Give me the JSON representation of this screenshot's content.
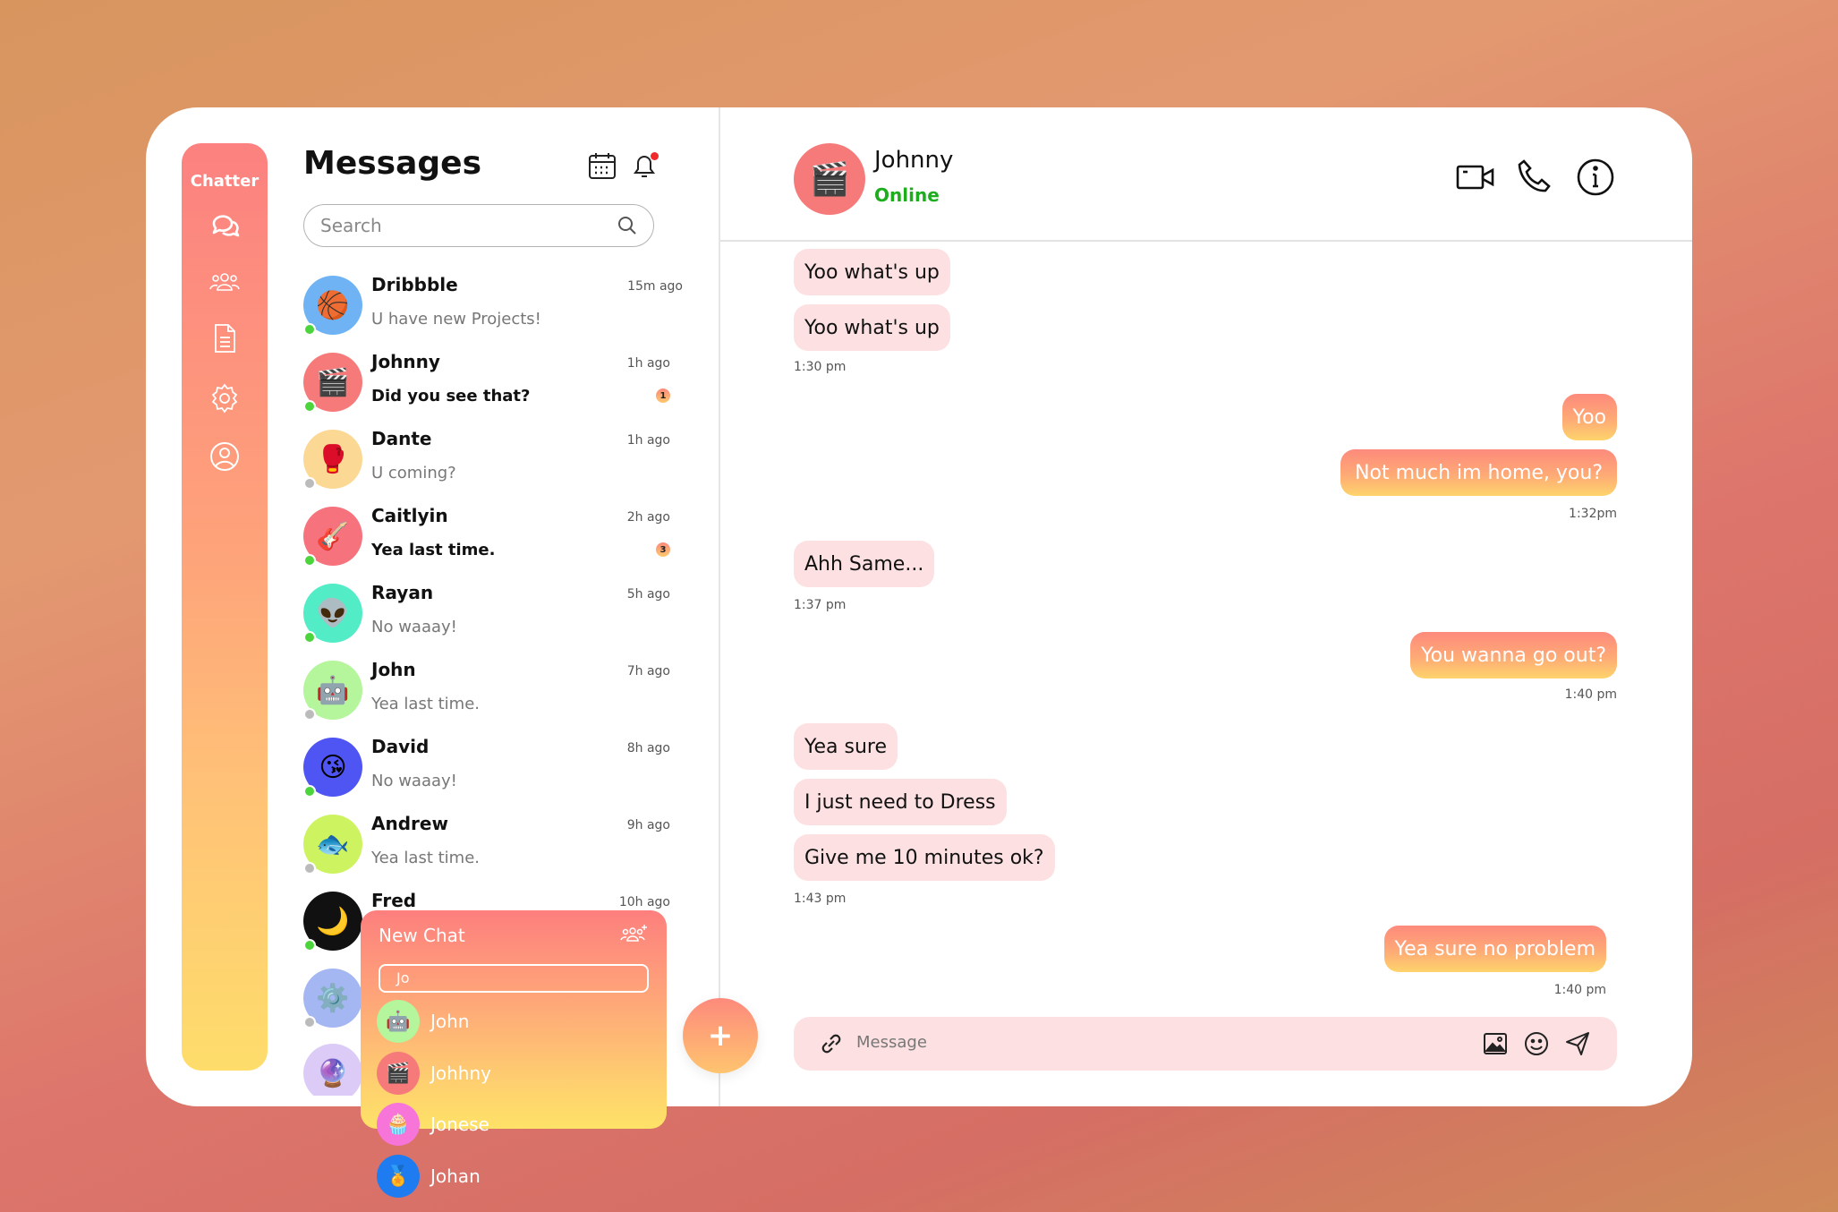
{
  "app": {
    "brand": "Chatter"
  },
  "rail": {
    "icons": [
      "chat-bubbles-icon",
      "group-icon",
      "document-icon",
      "settings-icon",
      "profile-icon"
    ]
  },
  "messages": {
    "title": "Messages",
    "search_placeholder": "Search",
    "contacts": [
      {
        "name": "Dribbble",
        "time": "15m ago",
        "preview": "U have new Projects!",
        "unread": null,
        "online": true
      },
      {
        "name": "Johnny",
        "time": "1h ago",
        "preview": "Did you see that?",
        "unread": "1",
        "online": true
      },
      {
        "name": "Dante",
        "time": "1h ago",
        "preview": "U coming?",
        "unread": null,
        "online": false
      },
      {
        "name": "Caitlyin",
        "time": "2h ago",
        "preview": "Yea last time.",
        "unread": "3",
        "online": true
      },
      {
        "name": "Rayan",
        "time": "5h ago",
        "preview": "No waaay!",
        "unread": null,
        "online": true
      },
      {
        "name": "John",
        "time": "7h ago",
        "preview": "Yea last time.",
        "unread": null,
        "online": false
      },
      {
        "name": "David",
        "time": "8h ago",
        "preview": "No waaay!",
        "unread": null,
        "online": true
      },
      {
        "name": "Andrew",
        "time": "9h ago",
        "preview": "Yea last time.",
        "unread": null,
        "online": false
      },
      {
        "name": "Fred",
        "time": "10h ago",
        "preview": "",
        "unread": null,
        "online": true
      }
    ]
  },
  "new_chat": {
    "title": "New Chat",
    "query": "Jo",
    "results": [
      "John",
      "Johhny",
      "Jonese",
      "Johan"
    ]
  },
  "chat": {
    "name": "Johnny",
    "status": "Online",
    "composer_placeholder": "Message",
    "messages": [
      {
        "text": "Yoo what's up",
        "dir": "in"
      },
      {
        "text": "Yoo what's up",
        "dir": "in"
      },
      {
        "time": "1:30 pm"
      },
      {
        "text": "Yoo",
        "dir": "out"
      },
      {
        "text": "Not much im home, you?",
        "dir": "out"
      },
      {
        "time": "1:32pm"
      },
      {
        "text": "Ahh Same...",
        "dir": "in"
      },
      {
        "time": "1:37 pm"
      },
      {
        "text": "You wanna go out?",
        "dir": "out"
      },
      {
        "time": "1:40 pm"
      },
      {
        "text": "Yea sure",
        "dir": "in"
      },
      {
        "text": "I just need to Dress",
        "dir": "in"
      },
      {
        "text": "Give me 10 minutes ok?",
        "dir": "in"
      },
      {
        "time": "1:43 pm"
      },
      {
        "text": "Yea sure no problem",
        "dir": "out"
      },
      {
        "time": "1:40 pm"
      }
    ]
  },
  "colors": {
    "online": "#4cd43c",
    "offline": "#bbbbbb",
    "accent": "#fd8a7c"
  }
}
